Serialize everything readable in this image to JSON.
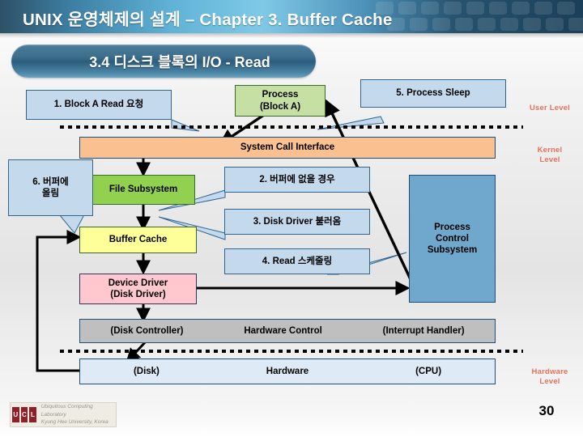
{
  "header": {
    "title": "UNIX 운영체제의 설계 – Chapter 3. Buffer Cache"
  },
  "section": {
    "pill_label": "3.4 디스크 블록의 I/O - Read"
  },
  "diagram": {
    "boxes": [
      {
        "id": "process",
        "label_line1": "Process",
        "label_line2": "(Block A)",
        "color": "#c6dfa3"
      },
      {
        "id": "system-call",
        "label_line1": "System Call Interface",
        "label_line2": "",
        "color": "#fac090"
      },
      {
        "id": "file-subsystem",
        "label_line1": "File Subsystem",
        "label_line2": "",
        "color": "#92d050"
      },
      {
        "id": "buffer-cache",
        "label_line1": "Buffer Cache",
        "label_line2": "",
        "color": "#ffff99"
      },
      {
        "id": "device-driver",
        "label_line1": "Device Driver",
        "label_line2": "(Disk Driver)",
        "color": "#ffc7ce"
      },
      {
        "id": "process-control",
        "label_line1": "Process",
        "label_line2": "Control",
        "label_line3": "Subsystem",
        "color": "#6fa8cc"
      },
      {
        "id": "hardware-control",
        "label_left": "(Disk Controller)",
        "label_mid": "Hardware Control",
        "label_right": "(Interrupt Handler)",
        "color": "#bfbfbf"
      },
      {
        "id": "hardware",
        "label_left": "(Disk)",
        "label_mid": "Hardware",
        "label_right": "(CPU)",
        "color": "#deeaf6"
      }
    ],
    "callouts": [
      {
        "id": "callout-1",
        "text": "1. Block A Read 요청"
      },
      {
        "id": "callout-2",
        "text": "2. 버퍼에 없을 경우"
      },
      {
        "id": "callout-3",
        "text": "3. Disk Driver 불러옴"
      },
      {
        "id": "callout-4",
        "text": "4. Read 스케줄링"
      },
      {
        "id": "callout-5",
        "text": "5. Process Sleep"
      },
      {
        "id": "callout-6",
        "text": "6. 버퍼에\n올림"
      }
    ],
    "levels": [
      {
        "id": "user-level",
        "text": "User Level"
      },
      {
        "id": "kernel-level",
        "text": "Kernel\nLevel"
      },
      {
        "id": "hardware-level",
        "text": "Hardware\nLevel"
      }
    ],
    "accent_colors": {
      "level_label": "#e8725a",
      "box_border": "#1f4e79",
      "callout_fill": "#c5d9ec",
      "callout_border": "#2e6690"
    }
  },
  "footer": {
    "logo_mark": [
      "U",
      "C",
      "L"
    ],
    "logo_line1": "Ubiquitous Computing Laboratory",
    "logo_line2": "Kyung Hee University, Korea",
    "page_number": "30"
  }
}
